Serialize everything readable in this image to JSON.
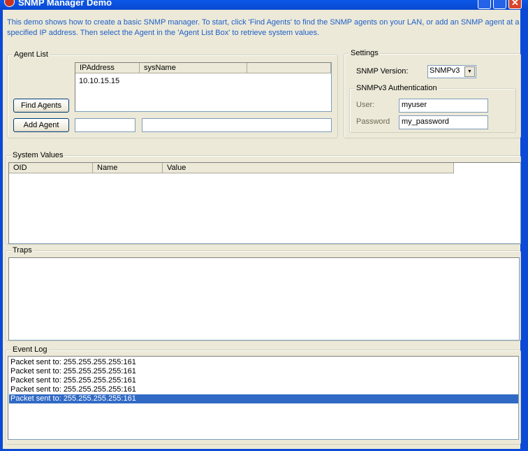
{
  "window": {
    "title": "SNMP Manager Demo"
  },
  "intro": "This demo shows how to create a basic SNMP manager.  To start, click 'Find Agents' to find the SNMP agents on your LAN, or add an SNMP agent at a specified IP address.  Then select the Agent in the 'Agent List Box' to retrieve system values.",
  "agent_list": {
    "label": "Agent List",
    "columns": [
      "IPAddress",
      "sysName",
      ""
    ],
    "rows": [
      [
        "10.10.15.15",
        ""
      ]
    ],
    "find_agents": "Find Agents",
    "add_agent": "Add Agent",
    "ip_input": "",
    "name_input": ""
  },
  "settings": {
    "label": "Settings",
    "version_label": "SNMP Version:",
    "version_value": "SNMPv3",
    "auth_label": "SNMPv3 Authentication",
    "user_label": "User:",
    "user_value": "myuser",
    "password_label": "Password",
    "password_value": "my_password"
  },
  "system_values": {
    "label": "System Values",
    "columns": [
      "OID",
      "Name",
      "Value"
    ]
  },
  "traps": {
    "label": "Traps"
  },
  "event_log": {
    "label": "Event Log",
    "items": [
      "Packet sent to: 255.255.255.255:161",
      "Packet sent to: 255.255.255.255:161",
      "Packet sent to: 255.255.255.255:161",
      "Packet sent to: 255.255.255.255:161",
      "Packet sent to: 255.255.255.255:161"
    ],
    "selected_index": 4
  },
  "colors": {
    "intro_text": "#1F5FC8",
    "selection": "#316AC5",
    "disabled_label": "#6d6a55"
  }
}
